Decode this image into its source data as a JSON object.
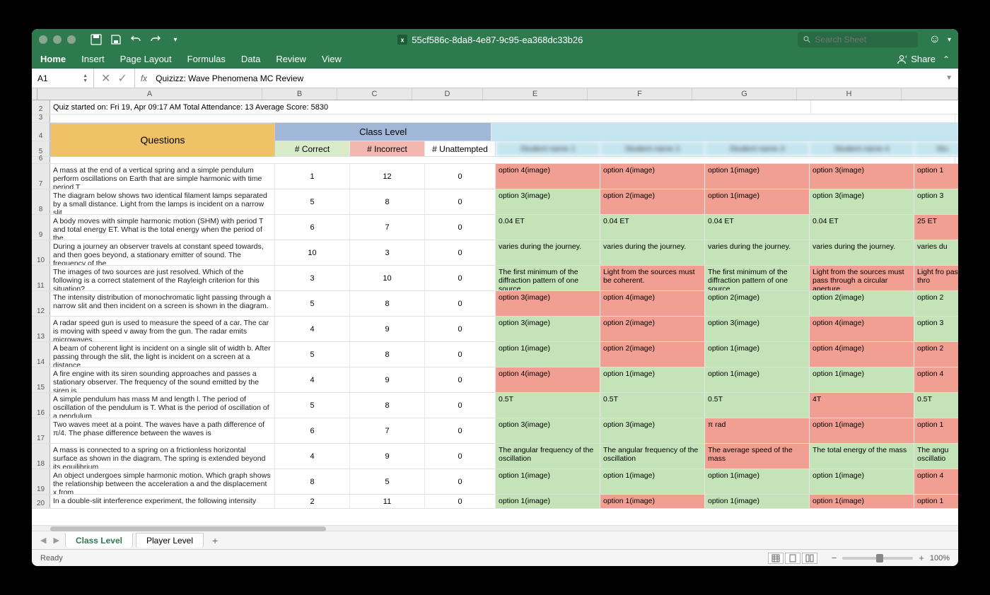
{
  "titlebar": {
    "doc_name": "55cf586c-8da8-4e87-9c95-ea368dc33b26",
    "search_placeholder": "Search Sheet"
  },
  "menu": [
    "Home",
    "Insert",
    "Page Layout",
    "Formulas",
    "Data",
    "Review",
    "View"
  ],
  "share_label": "Share",
  "formula_bar": {
    "name_box": "A1",
    "formula": "Quizizz: Wave Phenomena MC Review"
  },
  "columns": [
    "A",
    "B",
    "C",
    "D",
    "E",
    "F",
    "G",
    "H"
  ],
  "row2_text": "Quiz started on: Fri 19, Apr 09:17 AM Total Attendance: 13 Average Score: 5830",
  "headers": {
    "questions": "Questions",
    "class_level": "Class Level",
    "correct": "# Correct",
    "incorrect": "# Incorrect",
    "unattempted": "# Unattempted",
    "students": [
      "Student name 1",
      "Student name 2",
      "Student name 3",
      "Student name 4",
      "Stu"
    ]
  },
  "rows": [
    {
      "n": 7,
      "q": "A mass at the end of a vertical spring and a simple pendulum perform oscillations on Earth that are simple harmonic with time period T.",
      "c": 1,
      "i": 12,
      "u": 0,
      "ans": [
        [
          "option 4(image)",
          "r"
        ],
        [
          "option 4(image)",
          "r"
        ],
        [
          "option 1(image)",
          "r"
        ],
        [
          "option 3(image)",
          "r"
        ],
        [
          "option 1",
          "r"
        ]
      ]
    },
    {
      "n": 8,
      "q": "The diagram below shows two identical filament lamps separated by a small distance. Light from the lamps is incident on a narrow slit",
      "c": 5,
      "i": 8,
      "u": 0,
      "ans": [
        [
          "option 3(image)",
          "g"
        ],
        [
          "option 2(image)",
          "r"
        ],
        [
          "option 1(image)",
          "r"
        ],
        [
          "option 3(image)",
          "g"
        ],
        [
          "option 3",
          "g"
        ]
      ]
    },
    {
      "n": 9,
      "q": "A body moves with simple harmonic motion (SHM) with period T and total energy ET. What is the total energy when the period of the",
      "c": 6,
      "i": 7,
      "u": 0,
      "ans": [
        [
          "0.04 ET",
          "g"
        ],
        [
          "0.04 ET",
          "g"
        ],
        [
          "0.04 ET",
          "g"
        ],
        [
          "0.04 ET",
          "g"
        ],
        [
          "25 ET",
          "r"
        ]
      ]
    },
    {
      "n": 10,
      "q": "During a journey an observer travels at constant speed towards, and then goes beyond, a stationary emitter of sound. The frequency of the",
      "c": 10,
      "i": 3,
      "u": 0,
      "ans": [
        [
          "varies during the journey.",
          "g"
        ],
        [
          "varies during the journey.",
          "g"
        ],
        [
          "varies during the journey.",
          "g"
        ],
        [
          "varies during the journey.",
          "g"
        ],
        [
          "varies du",
          "g"
        ]
      ]
    },
    {
      "n": 11,
      "q": "The images of two sources are just resolved. Which of the following is a correct statement of the Rayleigh criterion for this situation?",
      "c": 3,
      "i": 10,
      "u": 0,
      "ans": [
        [
          "The first minimum of the diffraction pattern of one source",
          "g"
        ],
        [
          "Light from the sources must be coherent.",
          "r"
        ],
        [
          "The first minimum of the diffraction pattern of one source",
          "g"
        ],
        [
          "Light from the sources must pass through a circular aperture.",
          "r"
        ],
        [
          "Light fro pass thro",
          "r"
        ]
      ]
    },
    {
      "n": 12,
      "q": "The intensity distribution of monochromatic light passing through a narrow slit and then incident on a screen is shown in the diagram.",
      "c": 5,
      "i": 8,
      "u": 0,
      "ans": [
        [
          "option 3(image)",
          "r"
        ],
        [
          "option 4(image)",
          "r"
        ],
        [
          "option 2(image)",
          "g"
        ],
        [
          "option 2(image)",
          "g"
        ],
        [
          "option 2",
          "g"
        ]
      ]
    },
    {
      "n": 13,
      "q": "A radar speed gun is used to measure the speed of a car. The car is moving with speed v away from the gun. The radar emits microwaves",
      "c": 4,
      "i": 9,
      "u": 0,
      "ans": [
        [
          "option 3(image)",
          "g"
        ],
        [
          "option 2(image)",
          "r"
        ],
        [
          "option 3(image)",
          "g"
        ],
        [
          "option 4(image)",
          "r"
        ],
        [
          "option 3",
          "g"
        ]
      ]
    },
    {
      "n": 14,
      "q": "A beam of coherent light is incident on a single slit of width b. After passing through the slit, the light is incident on a screen at a distance",
      "c": 5,
      "i": 8,
      "u": 0,
      "ans": [
        [
          "option 1(image)",
          "g"
        ],
        [
          "option 2(image)",
          "r"
        ],
        [
          "option 1(image)",
          "g"
        ],
        [
          "option 4(image)",
          "r"
        ],
        [
          "option 2",
          "r"
        ]
      ]
    },
    {
      "n": 15,
      "q": "A fire engine with its siren sounding approaches and passes a stationary observer. The frequency of the sound emitted by the siren is",
      "c": 4,
      "i": 9,
      "u": 0,
      "ans": [
        [
          "option 4(image)",
          "r"
        ],
        [
          "option 1(image)",
          "g"
        ],
        [
          "option 1(image)",
          "g"
        ],
        [
          "option 1(image)",
          "g"
        ],
        [
          "option 4",
          "r"
        ]
      ]
    },
    {
      "n": 16,
      "q": "A simple pendulum has mass M and length l. The period of oscillation of the pendulum is T. What is the period of oscillation of a pendulum",
      "c": 5,
      "i": 8,
      "u": 0,
      "ans": [
        [
          "0.5T",
          "g"
        ],
        [
          "0.5T",
          "g"
        ],
        [
          "0.5T",
          "g"
        ],
        [
          "4T",
          "r"
        ],
        [
          "0.5T",
          "g"
        ]
      ]
    },
    {
      "n": 17,
      "q": "Two waves meet at a point. The waves have a path difference of π/4. The phase difference between the waves is",
      "c": 6,
      "i": 7,
      "u": 0,
      "ans": [
        [
          "option 3(image)",
          "g"
        ],
        [
          "option 3(image)",
          "g"
        ],
        [
          "π rad",
          "r"
        ],
        [
          "option 1(image)",
          "r"
        ],
        [
          "option 1",
          "r"
        ]
      ]
    },
    {
      "n": 18,
      "q": "A mass is connected to a spring on a frictionless horizontal surface as shown in the diagram. The spring is extended beyond its equilibrium",
      "c": 4,
      "i": 9,
      "u": 0,
      "ans": [
        [
          "The angular frequency of the oscillation",
          "g"
        ],
        [
          "The angular frequency of the oscillation",
          "g"
        ],
        [
          "The average speed of the mass",
          "r"
        ],
        [
          "The total energy of the mass",
          "g"
        ],
        [
          "The angu oscillatio",
          "g"
        ]
      ]
    },
    {
      "n": 19,
      "q": "An object undergoes simple harmonic motion. Which graph shows the relationship between the acceleration a and the displacement x from",
      "c": 8,
      "i": 5,
      "u": 0,
      "ans": [
        [
          "option 1(image)",
          "g"
        ],
        [
          "option 1(image)",
          "g"
        ],
        [
          "option 1(image)",
          "g"
        ],
        [
          "option 1(image)",
          "g"
        ],
        [
          "option 4",
          "r"
        ]
      ]
    },
    {
      "n": 20,
      "q": "In a double-slit interference experiment, the following intensity",
      "c": 2,
      "i": 11,
      "u": 0,
      "ans": [
        [
          "option 1(image)",
          "g"
        ],
        [
          "option 1(image)",
          "r"
        ],
        [
          "option 1(image)",
          "g"
        ],
        [
          "option 1(image)",
          "r"
        ],
        [
          "option 1",
          "r"
        ]
      ]
    }
  ],
  "sheet_tabs": {
    "active": "Class Level",
    "other": "Player Level"
  },
  "status": {
    "ready": "Ready",
    "zoom": "100%"
  }
}
